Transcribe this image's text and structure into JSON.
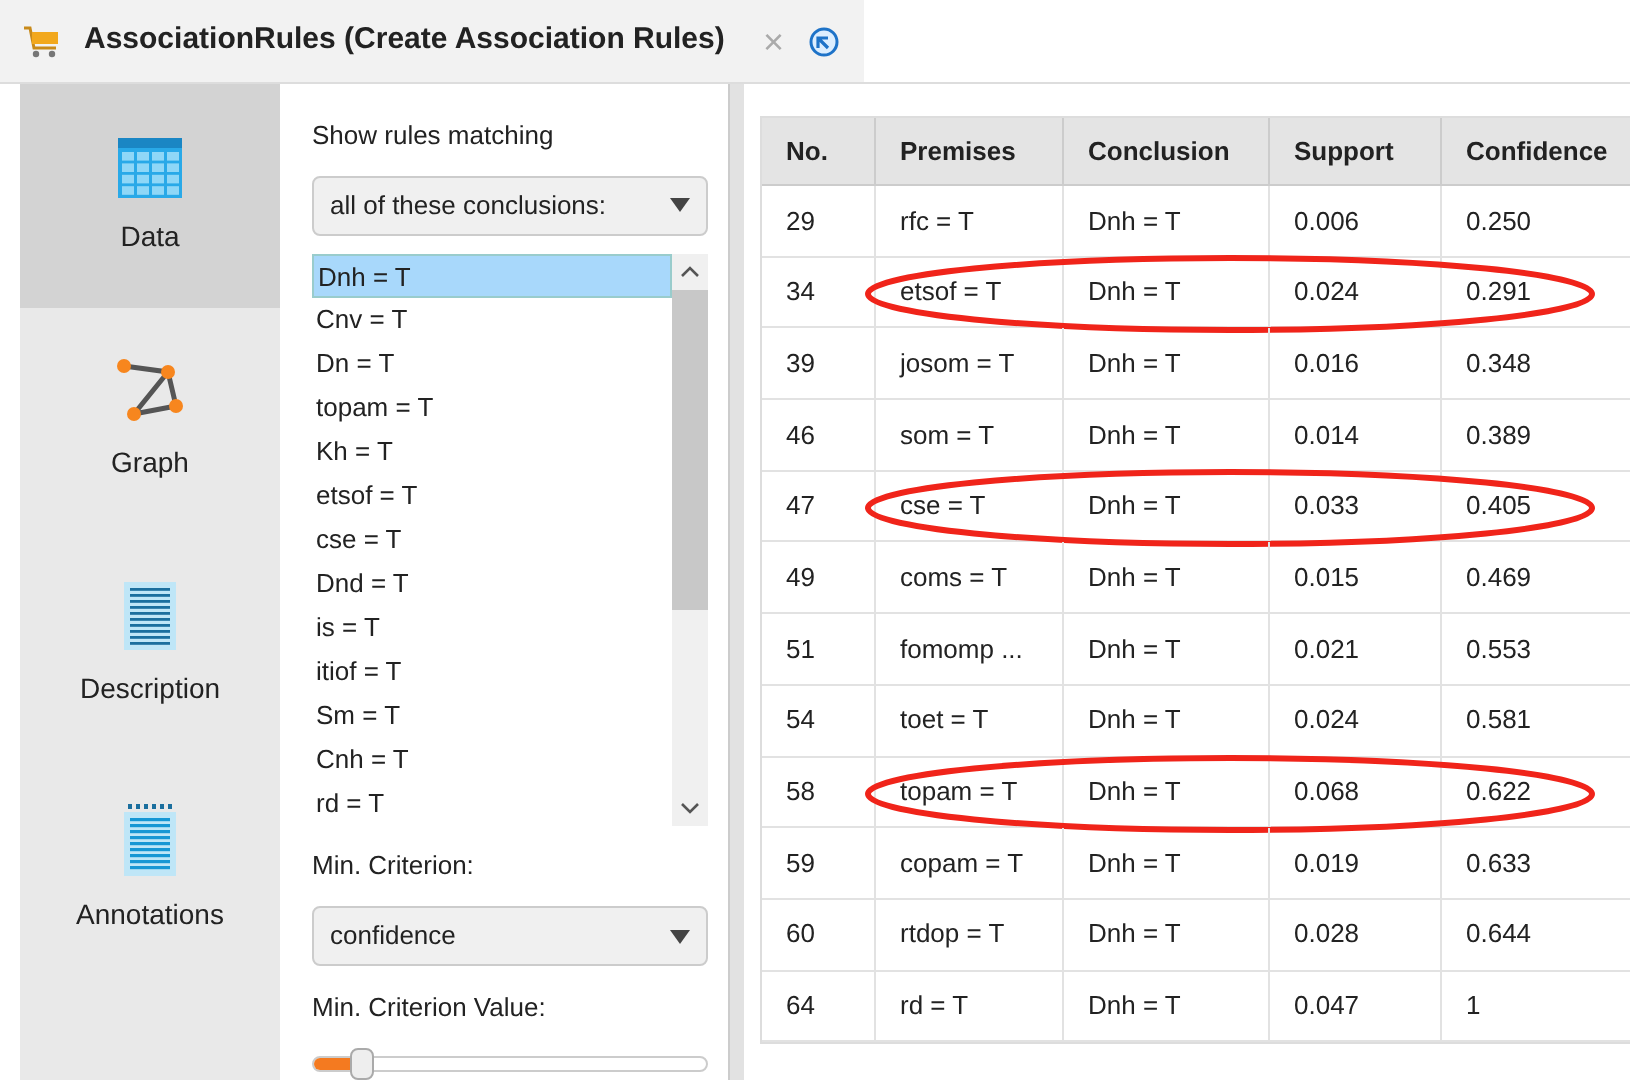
{
  "window": {
    "title": "AssociationRules (Create Association Rules)",
    "close": "×"
  },
  "nav": [
    {
      "label": "Data",
      "kind": "table",
      "selected": true
    },
    {
      "label": "Graph",
      "kind": "graph",
      "selected": false
    },
    {
      "label": "Description",
      "kind": "description",
      "selected": false
    },
    {
      "label": "Annotations",
      "kind": "annotations",
      "selected": false
    }
  ],
  "filter": {
    "label": "Show rules matching",
    "mode": "all of these conclusions:",
    "conclusions": [
      {
        "label": "Dnh = T",
        "selected": true
      },
      {
        "label": "Cnv = T",
        "selected": false
      },
      {
        "label": "Dn = T",
        "selected": false
      },
      {
        "label": "topam = T",
        "selected": false
      },
      {
        "label": "Kh = T",
        "selected": false
      },
      {
        "label": "etsof = T",
        "selected": false
      },
      {
        "label": "cse = T",
        "selected": false
      },
      {
        "label": "Dnd = T",
        "selected": false
      },
      {
        "label": "is = T",
        "selected": false
      },
      {
        "label": "itiof = T",
        "selected": false
      },
      {
        "label": "Sm = T",
        "selected": false
      },
      {
        "label": "Cnh = T",
        "selected": false
      },
      {
        "label": "rd = T",
        "selected": false
      }
    ],
    "criterion_label": "Min. Criterion:",
    "criterion": "confidence",
    "value_label": "Min. Criterion Value:",
    "value_slider": {
      "level": 0.12
    }
  },
  "table": {
    "columns": [
      "No.",
      "Premises",
      "Conclusion",
      "Support",
      "Confidence"
    ],
    "rows": [
      {
        "cells": [
          "29",
          "rfc = T",
          "Dnh = T",
          "0.006",
          "0.250"
        ],
        "circled": false
      },
      {
        "cells": [
          "34",
          "etsof = T",
          "Dnh = T",
          "0.024",
          "0.291"
        ],
        "circled": true
      },
      {
        "cells": [
          "39",
          "josom = T",
          "Dnh = T",
          "0.016",
          "0.348"
        ],
        "circled": false
      },
      {
        "cells": [
          "46",
          "som = T",
          "Dnh = T",
          "0.014",
          "0.389"
        ],
        "circled": false
      },
      {
        "cells": [
          "47",
          "cse = T",
          "Dnh = T",
          "0.033",
          "0.405"
        ],
        "circled": true
      },
      {
        "cells": [
          "49",
          "coms = T",
          "Dnh = T",
          "0.015",
          "0.469"
        ],
        "circled": false
      },
      {
        "cells": [
          "51",
          "fomomp ...",
          "Dnh = T",
          "0.021",
          "0.553"
        ],
        "circled": false
      },
      {
        "cells": [
          "54",
          "toet = T",
          "Dnh = T",
          "0.024",
          "0.581"
        ],
        "circled": false
      },
      {
        "cells": [
          "58",
          "topam = T",
          "Dnh = T",
          "0.068",
          "0.622"
        ],
        "circled": true
      },
      {
        "cells": [
          "59",
          "copam = T",
          "Dnh = T",
          "0.019",
          "0.633"
        ],
        "circled": false
      },
      {
        "cells": [
          "60",
          "rtdop = T",
          "Dnh = T",
          "0.028",
          "0.644"
        ],
        "circled": false
      },
      {
        "cells": [
          "64",
          "rd = T",
          "Dnh = T",
          "0.047",
          "1"
        ],
        "circled": false
      }
    ]
  }
}
